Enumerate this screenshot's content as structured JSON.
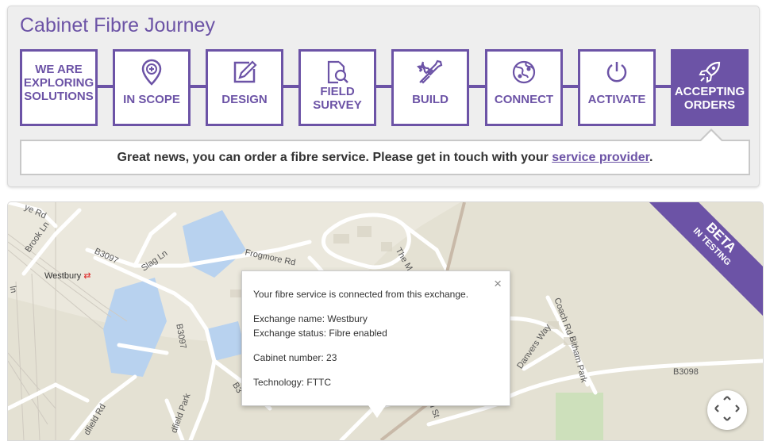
{
  "journey": {
    "title": "Cabinet Fibre Journey",
    "accent": "#6c53a6",
    "steps": [
      {
        "label": "WE ARE EXPLORING SOLUTIONS",
        "icon": "none",
        "active": false
      },
      {
        "label": "IN SCOPE",
        "icon": "map-pin-plus-icon",
        "active": false
      },
      {
        "label": "DESIGN",
        "icon": "pencil-square-icon",
        "active": false
      },
      {
        "label": "FIELD SURVEY",
        "icon": "document-search-icon",
        "active": false
      },
      {
        "label": "BUILD",
        "icon": "wrench-screwdriver-icon",
        "active": false
      },
      {
        "label": "CONNECT",
        "icon": "globe-icon",
        "active": false
      },
      {
        "label": "ACTIVATE",
        "icon": "power-icon",
        "active": false
      },
      {
        "label": "ACCEPTING ORDERS",
        "icon": "rocket-icon",
        "active": true
      }
    ],
    "message": {
      "prefix": "Great news, you can order a fibre service. Please get in touch with your ",
      "link": "service provider",
      "suffix": "."
    }
  },
  "map": {
    "beta_badge": {
      "title": "BETA",
      "subtitle": "IN TESTING"
    },
    "labels": [
      "Westbury",
      "B3097",
      "Slag Ln",
      "Brook Ln",
      "ye Rd",
      "Frogmore Rd",
      "The M",
      "B3097",
      "B3098",
      "Coach Rd",
      "Bitham Park",
      "Danvers Way",
      "dfield Rd",
      "dfield Park",
      "B3",
      "d St",
      "ln"
    ],
    "popup": {
      "line1": "Your fibre service is connected from this exchange.",
      "exchange_name": "Exchange name: Westbury",
      "exchange_status": "Exchange status: Fibre enabled",
      "cabinet_number": "Cabinet number: 23",
      "technology": "Technology: FTTC",
      "close_symbol": "×"
    }
  }
}
